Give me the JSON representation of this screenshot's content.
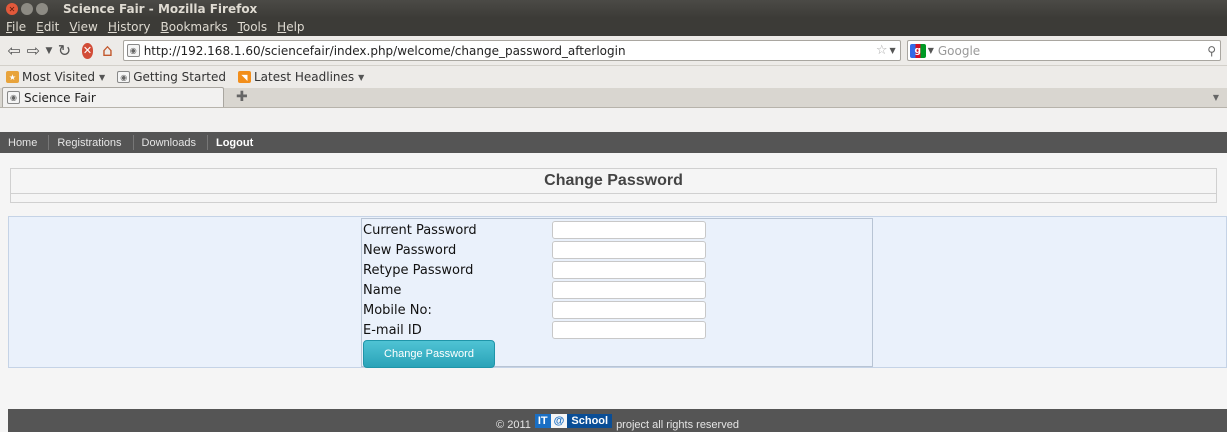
{
  "window": {
    "title": "Science Fair - Mozilla Firefox"
  },
  "menu": [
    "File",
    "Edit",
    "View",
    "History",
    "Bookmarks",
    "Tools",
    "Help"
  ],
  "navbar": {
    "url": "http://192.168.1.60/sciencefair/index.php/welcome/change_password_afterlogin",
    "search_placeholder": "Google"
  },
  "bookmarks": [
    {
      "label": "Most Visited",
      "dropdown": true
    },
    {
      "label": "Getting Started",
      "dropdown": false
    },
    {
      "label": "Latest Headlines",
      "dropdown": true
    }
  ],
  "tabs": [
    {
      "label": "Science Fair"
    }
  ],
  "site": {
    "nav": [
      "Home",
      "Registrations",
      "Downloads",
      "Logout"
    ],
    "page_title": "Change Password",
    "form": {
      "fields": [
        "Current Password",
        "New Password",
        "Retype Password",
        "Name",
        "Mobile No:",
        "E-mail ID"
      ],
      "submit_label": "Change Password"
    },
    "footer": {
      "copyright": "© 2011",
      "logo_it": "IT",
      "logo_at": "@",
      "logo_school": "School",
      "rights": "project all rights reserved"
    }
  },
  "colors": {
    "site_nav_bg": "#555555",
    "form_band_bg": "#eaf1fb",
    "button_teal": "#2aa3b8",
    "titlebar_bg": "#3c3b37"
  }
}
